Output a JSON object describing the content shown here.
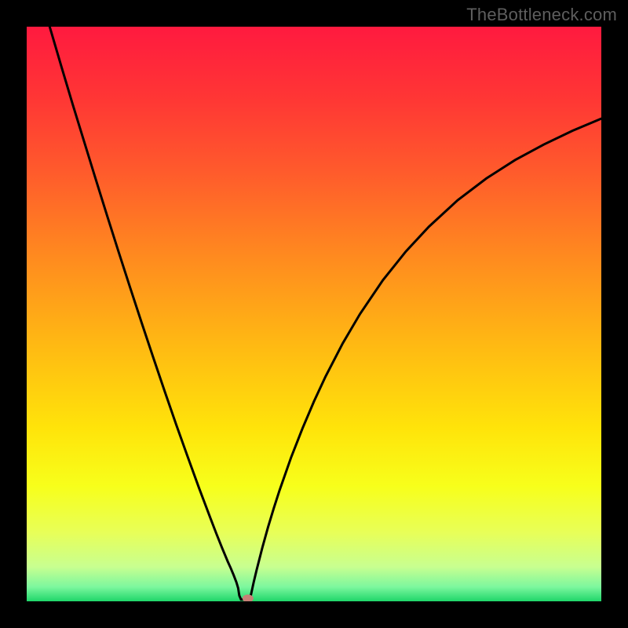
{
  "watermark": "TheBottleneck.com",
  "chart_data": {
    "type": "line",
    "title": "",
    "xlabel": "",
    "ylabel": "",
    "xlim": [
      0,
      100
    ],
    "ylim": [
      0,
      100
    ],
    "grid": false,
    "min_point_x": 37,
    "marker": {
      "x": 38.5,
      "y": 0.5,
      "color": "#c78076"
    },
    "gradient_stops": [
      {
        "offset": 0.0,
        "color": "#ff1a3f"
      },
      {
        "offset": 0.12,
        "color": "#ff3535"
      },
      {
        "offset": 0.25,
        "color": "#ff5a2c"
      },
      {
        "offset": 0.4,
        "color": "#ff8a1f"
      },
      {
        "offset": 0.55,
        "color": "#ffb813"
      },
      {
        "offset": 0.7,
        "color": "#ffe40a"
      },
      {
        "offset": 0.8,
        "color": "#f7ff1b"
      },
      {
        "offset": 0.88,
        "color": "#e8ff58"
      },
      {
        "offset": 0.94,
        "color": "#c8ff90"
      },
      {
        "offset": 0.975,
        "color": "#7cf79e"
      },
      {
        "offset": 1.0,
        "color": "#1fd66a"
      }
    ],
    "curve": [
      {
        "x": 4.0,
        "y": 100.0
      },
      {
        "x": 6.0,
        "y": 93.2
      },
      {
        "x": 8.0,
        "y": 86.5
      },
      {
        "x": 10.0,
        "y": 80.0
      },
      {
        "x": 12.0,
        "y": 73.5
      },
      {
        "x": 14.0,
        "y": 67.1
      },
      {
        "x": 16.0,
        "y": 60.8
      },
      {
        "x": 18.0,
        "y": 54.6
      },
      {
        "x": 20.0,
        "y": 48.5
      },
      {
        "x": 22.0,
        "y": 42.5
      },
      {
        "x": 24.0,
        "y": 36.6
      },
      {
        "x": 26.0,
        "y": 30.8
      },
      {
        "x": 28.0,
        "y": 25.2
      },
      {
        "x": 30.0,
        "y": 19.7
      },
      {
        "x": 32.0,
        "y": 14.4
      },
      {
        "x": 33.0,
        "y": 11.8
      },
      {
        "x": 34.0,
        "y": 9.3
      },
      {
        "x": 35.0,
        "y": 6.9
      },
      {
        "x": 35.5,
        "y": 5.8
      },
      {
        "x": 36.0,
        "y": 4.6
      },
      {
        "x": 36.5,
        "y": 3.3
      },
      {
        "x": 36.8,
        "y": 2.3
      },
      {
        "x": 37.0,
        "y": 1.0
      },
      {
        "x": 37.3,
        "y": 0.3
      },
      {
        "x": 38.7,
        "y": 0.3
      },
      {
        "x": 39.0,
        "y": 1.0
      },
      {
        "x": 39.5,
        "y": 3.3
      },
      {
        "x": 40.0,
        "y": 5.4
      },
      {
        "x": 41.0,
        "y": 9.3
      },
      {
        "x": 42.0,
        "y": 12.9
      },
      {
        "x": 43.0,
        "y": 16.2
      },
      {
        "x": 44.0,
        "y": 19.3
      },
      {
        "x": 46.0,
        "y": 25.0
      },
      {
        "x": 48.0,
        "y": 30.1
      },
      {
        "x": 50.0,
        "y": 34.8
      },
      {
        "x": 52.0,
        "y": 39.1
      },
      {
        "x": 55.0,
        "y": 44.9
      },
      {
        "x": 58.0,
        "y": 50.0
      },
      {
        "x": 62.0,
        "y": 55.9
      },
      {
        "x": 66.0,
        "y": 60.9
      },
      {
        "x": 70.0,
        "y": 65.2
      },
      {
        "x": 75.0,
        "y": 69.8
      },
      {
        "x": 80.0,
        "y": 73.6
      },
      {
        "x": 85.0,
        "y": 76.8
      },
      {
        "x": 90.0,
        "y": 79.5
      },
      {
        "x": 95.0,
        "y": 81.9
      },
      {
        "x": 100.0,
        "y": 84.0
      }
    ]
  }
}
